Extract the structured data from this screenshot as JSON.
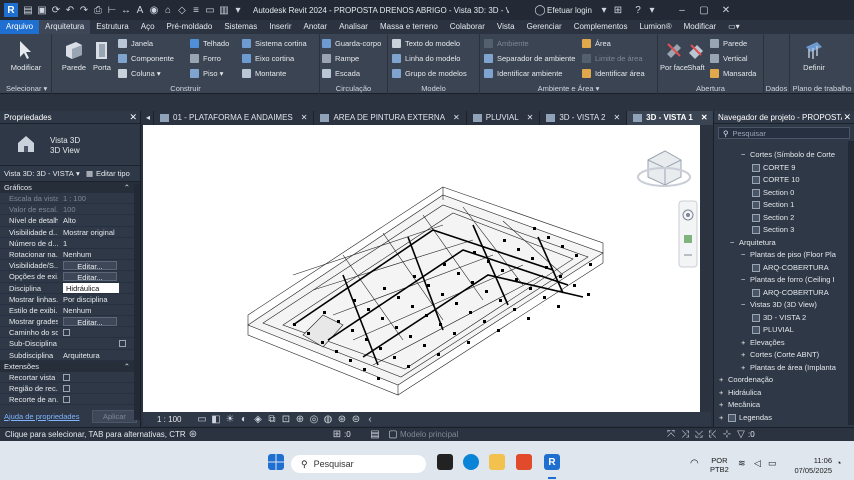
{
  "titlebar": {
    "title": "Autodesk Revit 2024 - PROPOSTA DRENOS ABRIGO - Vista 3D: 3D - VISTA 1",
    "login": "Efetuar login"
  },
  "menu_tabs": [
    "Arquivo",
    "Arquitetura",
    "Estrutura",
    "Aço",
    "Pré-moldado",
    "Sistemas",
    "Inserir",
    "Anotar",
    "Analisar",
    "Massa e terreno",
    "Colaborar",
    "Vista",
    "Gerenciar",
    "Complementos",
    "Lumion®",
    "Modificar"
  ],
  "ribbon": {
    "select": {
      "modify": "Modificar",
      "label": "Selecionar ▾"
    },
    "build": {
      "wall": "Parede",
      "door": "Porta",
      "window": "Janela",
      "component": "Componente",
      "column": "Coluna ▾",
      "roof": "Telhado",
      "ceiling": "Forro",
      "floor": "Piso ▾",
      "curtain_system": "Sistema cortina",
      "curtain_grid": "Eixo cortina",
      "mullion": "Montante",
      "label": "Construir"
    },
    "circulation": {
      "railing": "Guarda-corpo",
      "ramp": "Rampe",
      "stair": "Escada",
      "label": "Circulação"
    },
    "model": {
      "text": "Texto do modelo",
      "line": "Linha do modelo",
      "group": "Grupo de modelos",
      "label": "Modelo"
    },
    "room": {
      "room": "Ambiente",
      "separator": "Separador de ambiente",
      "tag": "Identificar ambiente",
      "area": "Área",
      "area_boundary": "Limite de área",
      "area_tag": "Identificar área",
      "label": "Ambiente e Área ▾"
    },
    "opening": {
      "by_face": "Por face",
      "shaft": "Shaft",
      "wall": "Parede",
      "vertical": "Vertical",
      "dormer": "Mansarda",
      "label": "Abertura"
    },
    "datum": {
      "label": "Dados"
    },
    "workplane": {
      "set": "Definir",
      "label": "Plano de trabalho"
    }
  },
  "doc_tabs": [
    "01 - PLATAFORMA E ANDAIMES",
    "AREA DE PINTURA EXTERNA",
    "PLUVIAL",
    "3D - VISTA 2",
    "3D - VISTA 1"
  ],
  "properties": {
    "title": "Propriedades",
    "type_name": "Vista 3D",
    "type_sub": "3D View",
    "selector": "Vista 3D: 3D - VISTA",
    "edit_type": "Editar tipo",
    "section_graphics": "Gráficos",
    "rows": [
      {
        "k": "Escala da vista",
        "v": "1 : 100"
      },
      {
        "k": "Valor de escal...",
        "v": "100"
      },
      {
        "k": "Nível de detalhe",
        "v": "Alto"
      },
      {
        "k": "Visibilidade d...",
        "v": "Mostrar original"
      },
      {
        "k": "Número de d...",
        "v": "1"
      },
      {
        "k": "Rotacionar na...",
        "v": "Nenhum"
      },
      {
        "k": "Visibilidade/S...",
        "v": "Editar..."
      },
      {
        "k": "Opções de exi...",
        "v": "Editar..."
      },
      {
        "k": "Disciplina",
        "v": "Hidráulica"
      },
      {
        "k": "Mostrar linhas...",
        "v": "Por disciplina"
      },
      {
        "k": "Estilo de exibi...",
        "v": "Nenhum"
      },
      {
        "k": "Mostrar grades",
        "v": "Editar..."
      },
      {
        "k": "Caminho do sol",
        "v": ""
      },
      {
        "k": "Sub-Disciplina",
        "v": ""
      },
      {
        "k": "Subdisciplina",
        "v": "Arquitetura"
      }
    ],
    "section_extents": "Extensões",
    "ext_rows": [
      {
        "k": "Recortar vista",
        "v": ""
      },
      {
        "k": "Região de rec...",
        "v": ""
      },
      {
        "k": "Recorte de an...",
        "v": ""
      }
    ],
    "help": "Ajuda de propriedades",
    "apply": "Aplicar"
  },
  "view_status": {
    "scale": "1 : 100"
  },
  "browser": {
    "title": "Navegador de projeto - PROPOSTA...",
    "search": "Pesquisar",
    "nodes": [
      {
        "t": "Cortes (Símbolo de Corte",
        "lvl": 3,
        "exp": "−"
      },
      {
        "t": "CORTE 9",
        "lvl": 4,
        "v": true
      },
      {
        "t": "CORTE 10",
        "lvl": 4,
        "v": true
      },
      {
        "t": "Section 0",
        "lvl": 4,
        "v": true
      },
      {
        "t": "Section 1",
        "lvl": 4,
        "v": true
      },
      {
        "t": "Section 2",
        "lvl": 4,
        "v": true
      },
      {
        "t": "Section 3",
        "lvl": 4,
        "v": true
      },
      {
        "t": "Arquitetura",
        "lvl": 2,
        "exp": "−"
      },
      {
        "t": "Plantas de piso (Floor Pla",
        "lvl": 3,
        "exp": "−"
      },
      {
        "t": "ARQ-COBERTURA",
        "lvl": 4,
        "v": true
      },
      {
        "t": "Plantas de forro (Ceiling I",
        "lvl": 3,
        "exp": "−"
      },
      {
        "t": "ARQ-COBERTURA",
        "lvl": 4,
        "v": true
      },
      {
        "t": "Vistas 3D (3D View)",
        "lvl": 3,
        "exp": "−"
      },
      {
        "t": "3D - VISTA 2",
        "lvl": 4,
        "v": true
      },
      {
        "t": "PLUVIAL",
        "lvl": 4,
        "v": true
      },
      {
        "t": "Elevações",
        "lvl": 3,
        "exp": "+"
      },
      {
        "t": "Cortes (Corte ABNT)",
        "lvl": 3,
        "exp": "+"
      },
      {
        "t": "Plantas de área (Implanta",
        "lvl": 3,
        "exp": "+"
      },
      {
        "t": "Coordenação",
        "lvl": 1,
        "exp": "+"
      },
      {
        "t": "Hidráulica",
        "lvl": 1,
        "exp": "+"
      },
      {
        "t": "Mecânica",
        "lvl": 1,
        "exp": "+"
      },
      {
        "t": "Legendas",
        "lvl": 1,
        "exp": "+"
      }
    ]
  },
  "statusbar": {
    "hint": "Clique para selecionar, TAB para alternativas, CTRL adici",
    "zero1": ":0",
    "workset": "Modelo principal",
    "zero2": ":0"
  },
  "taskbar": {
    "search": "Pesquisar",
    "lang1": "POR",
    "lang2": "PTB2",
    "time": "11:06",
    "date": "07/05/2025"
  },
  "colors": {
    "accent": "#1f6fd1",
    "panel": "#2f3846",
    "ribbon": "#3b4452"
  }
}
